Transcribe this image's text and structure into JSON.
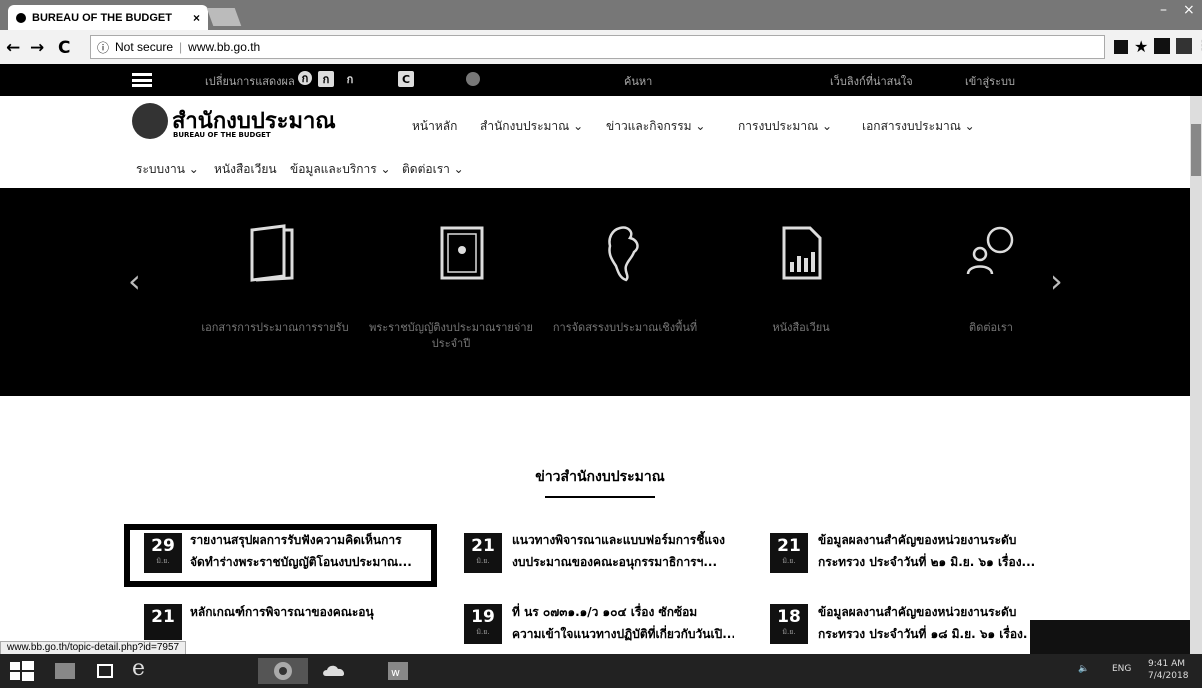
{
  "browser": {
    "tab_title": "BUREAU OF THE BUDGET",
    "tab_close": "×",
    "not_secure": "Not secure",
    "url": "www.bb.go.th",
    "back": "←",
    "forward": "→",
    "reload": "C",
    "info": "ⓘ",
    "status_url": "www.bb.go.th/topic-detail.php?id=7957"
  },
  "topbar": {
    "accessibility_label": "เปลี่ยนการแสดงผล",
    "sq_a1": "ก",
    "sq_a2": "ก",
    "sq_a3": "ก",
    "sq_c": "C",
    "search_label": "ค้นหา",
    "link1": "เว็บลิงก์ที่น่าสนใจ",
    "link2": "เข้าสู่ระบบ"
  },
  "logo": {
    "th": "สำนักงบประมาณ",
    "en": "BUREAU OF THE BUDGET"
  },
  "menu": {
    "row1": [
      "หน้าหลัก",
      "สำนักงบประมาณ ⌄",
      "ข่าวและกิจกรรม ⌄",
      "การงบประมาณ ⌄",
      "เอกสารงบประมาณ ⌄"
    ],
    "row2": [
      "ระบบงาน ⌄",
      "หนังสือเวียน",
      "ข้อมูลและบริการ ⌄",
      "ติดต่อเรา ⌄"
    ]
  },
  "hero": {
    "prev": "‹",
    "next": "›",
    "captions": [
      "เอกสารการประมาณการรายรับ",
      "พระราชบัญญัติงบประมาณรายจ่ายประจำปี",
      "การจัดสรรงบประมาณเชิงพื้นที่",
      "หนังสือเวียน",
      "ติดต่อเรา"
    ]
  },
  "news": {
    "title": "ข่าวสำนักงบประมาณ",
    "items": [
      {
        "day": "29",
        "month": "มิ.ย.",
        "line1": "รายงานสรุปผลการรับฟังความคิดเห็นการ",
        "line2": "จัดทำร่างพระราชบัญญัติโอนงบประมาณ..."
      },
      {
        "day": "21",
        "month": "มิ.ย.",
        "line1": "แนวทางพิจารณาและแบบฟอร์มการชี้แจง",
        "line2": "งบประมาณของคณะอนุกรรมาธิการฯ..."
      },
      {
        "day": "21",
        "month": "มิ.ย.",
        "line1": "ข้อมูลผลงานสำคัญของหน่วยงานระดับ",
        "line2": "กระทรวง ประจำวันที่ ๒๑ มิ.ย. ๖๑ เรื่อง..."
      },
      {
        "day": "21",
        "month": "มิ.ย.",
        "line1": "หลักเกณฑ์การพิจารณาของคณะอนุ",
        "line2": ""
      },
      {
        "day": "19",
        "month": "มิ.ย.",
        "line1": "ที่ นร ๐๗๓๑.๑/ว ๑๐๔ เรื่อง ซักซ้อม",
        "line2": "ความเข้าใจแนวทางปฏิบัติที่เกี่ยวกับวันเปิ..."
      },
      {
        "day": "18",
        "month": "มิ.ย.",
        "line1": "ข้อมูลผลงานสำคัญของหน่วยงานระดับ",
        "line2": "กระทรวง ประจำวันที่ ๑๘ มิ.ย. ๖๑ เรื่อง..."
      }
    ]
  },
  "taskbar": {
    "lang": "ENG",
    "time": "9:41 AM",
    "date": "7/4/2018"
  }
}
